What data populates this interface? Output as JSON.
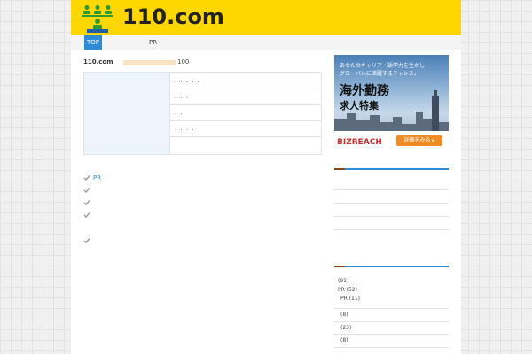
{
  "header": {
    "site_title": "110.com",
    "logo_icon": "people-group-icon",
    "bg_color": "#ffd700"
  },
  "nav": {
    "items": [
      {
        "label": "TOP"
      },
      {
        "label": "PR"
      }
    ],
    "active_color": "#2d8bd6"
  },
  "rank": {
    "label": "110.com",
    "value": "100"
  },
  "info_rows": [
    ". . . . .",
    ". . .",
    ". .",
    ". . .  ."
  ],
  "checklist": [
    {
      "label": "PR"
    },
    {
      "label": ""
    },
    {
      "label": ""
    },
    {
      "label": ""
    },
    {
      "label": ""
    }
  ],
  "ad": {
    "sub": "あなたのキャリア・語学力を生かし\nグローバルに活躍するチャンス。",
    "title": "海外勤務",
    "subtitle": "求人特集",
    "brand": "BIZREACH",
    "cta": "詳細をみる ▸"
  },
  "categories": [
    {
      "label": "(91)"
    },
    {
      "label": "PR (52)"
    },
    {
      "label": "PR (11)"
    },
    {
      "label": "(8)"
    },
    {
      "label": "(23)"
    },
    {
      "label": "(8)"
    }
  ]
}
